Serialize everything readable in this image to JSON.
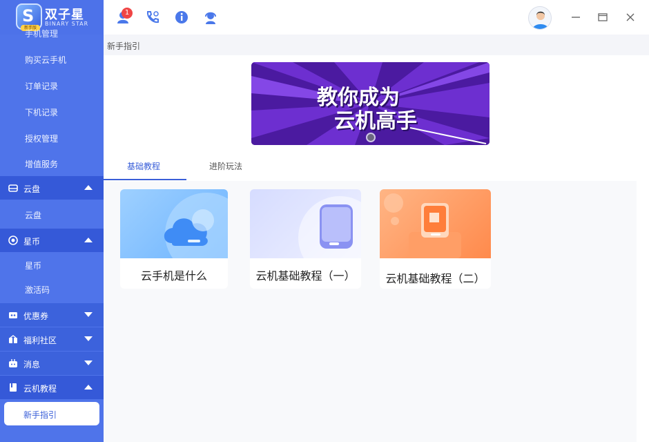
{
  "app": {
    "title": "双子星",
    "subtitle": "BINARY STAR",
    "badge": "新手版"
  },
  "sidebar": {
    "cut_item": "手机管理",
    "items_top": [
      "购买云手机",
      "订单记录",
      "下机记录",
      "授权管理",
      "增值服务"
    ],
    "groups": [
      {
        "label": "云盘",
        "icon": "cloud-disk-icon",
        "state": "expanded",
        "children": [
          "云盘"
        ]
      },
      {
        "label": "星币",
        "icon": "star-coin-icon",
        "state": "expanded",
        "children": [
          "星币",
          "激活码"
        ]
      },
      {
        "label": "优惠券",
        "icon": "coupon-icon",
        "state": "collapsed",
        "children": []
      },
      {
        "label": "福利社区",
        "icon": "gift-icon",
        "state": "collapsed",
        "children": []
      },
      {
        "label": "消息",
        "icon": "message-icon",
        "state": "collapsed",
        "children": []
      },
      {
        "label": "云机教程",
        "icon": "tutorial-book-icon",
        "state": "expanded",
        "children": [
          "新手指引"
        ]
      }
    ],
    "active_item": "新手指引"
  },
  "topbar": {
    "icons": [
      "user-icon",
      "phone-call-icon",
      "info-icon",
      "customer-service-icon"
    ],
    "notification_count": "1",
    "window_controls": [
      "minimize-icon",
      "maximize-icon",
      "close-icon"
    ]
  },
  "breadcrumb": "新手指引",
  "banner": {
    "line1": "教你成为",
    "line2": "云机高手"
  },
  "tabs": [
    {
      "label": "基础教程",
      "active": true
    },
    {
      "label": "进阶玩法",
      "active": false
    }
  ],
  "cards": [
    {
      "title": "云手机是什么",
      "thumb": "cloud-icon",
      "color": "#8cc6ff"
    },
    {
      "title": "云机基础教程（一）",
      "thumb": "phone-icon",
      "color": "#c9d2ff"
    },
    {
      "title": "云机基础教程（二）",
      "thumb": "tablet-expand-icon",
      "color": "#ff9b63"
    }
  ],
  "colors": {
    "sidebar": "#4f74ea",
    "accent": "#3a5fd8",
    "badge": "#f04545"
  }
}
